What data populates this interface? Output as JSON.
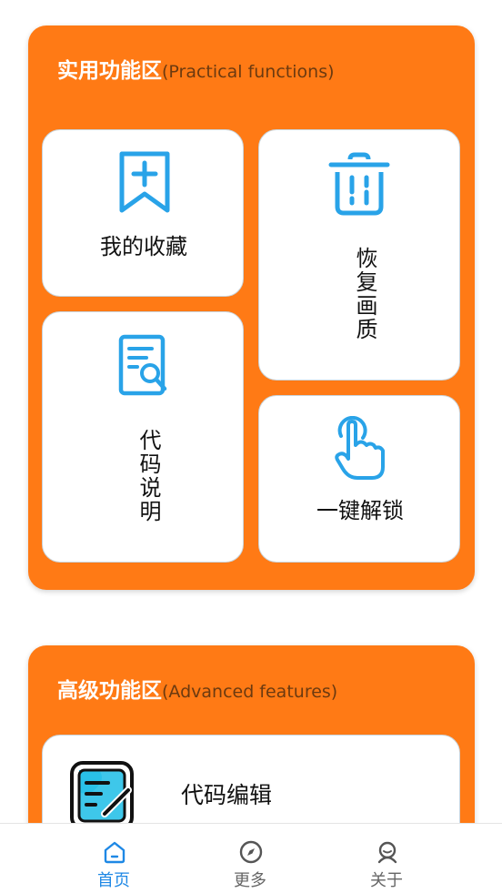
{
  "practical": {
    "title": "实用功能区",
    "subtitle": "(Practical functions)",
    "items": [
      {
        "label": "我的收藏",
        "icon": "bookmark-add-icon"
      },
      {
        "label": "恢复画质",
        "icon": "trash-icon"
      },
      {
        "label": "代码说明",
        "icon": "document-search-icon"
      },
      {
        "label": "一键解锁",
        "icon": "tap-finger-icon"
      }
    ]
  },
  "advanced": {
    "title": "高级功能区",
    "subtitle": "(Advanced features)",
    "items": [
      {
        "label": "代码编辑",
        "icon": "code-edit-icon"
      }
    ]
  },
  "nav": {
    "items": [
      {
        "label": "首页",
        "icon": "home-icon",
        "active": true
      },
      {
        "label": "更多",
        "icon": "compass-icon",
        "active": false
      },
      {
        "label": "关于",
        "icon": "user-icon",
        "active": false
      }
    ]
  },
  "colors": {
    "panel": "#ff7a15",
    "icon_blue": "#29a3e8",
    "active": "#1e88e5"
  }
}
